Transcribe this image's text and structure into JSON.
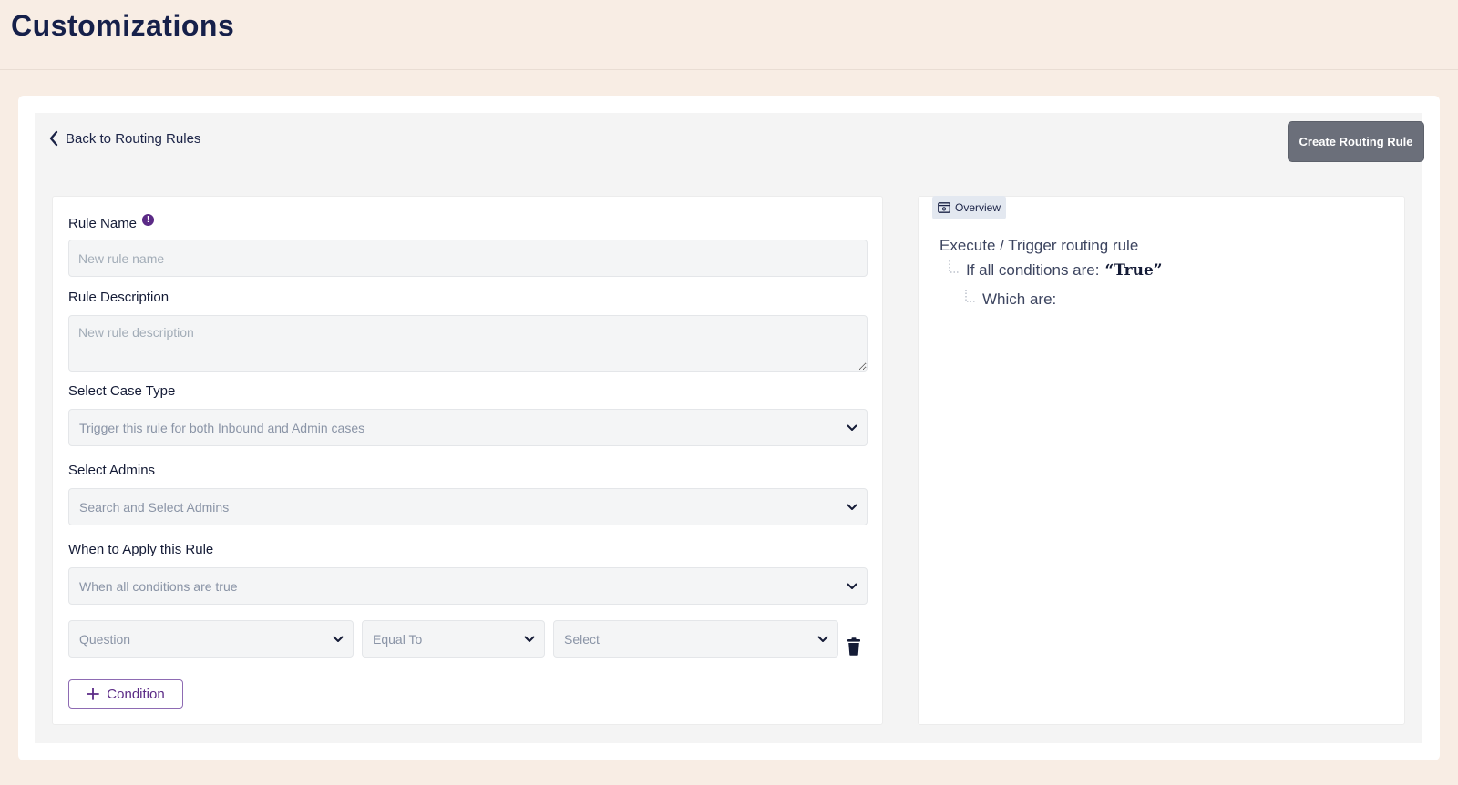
{
  "page": {
    "title": "Customizations"
  },
  "top_bar": {
    "back_label": "Back to Routing Rules",
    "create_button": "Create Routing Rule"
  },
  "form": {
    "rule_name": {
      "label": "Rule Name",
      "info_icon": "info-icon",
      "placeholder": "New rule name",
      "value": ""
    },
    "rule_description": {
      "label": "Rule Description",
      "placeholder": "New rule description",
      "value": ""
    },
    "case_type": {
      "label": "Select Case Type",
      "value": "Trigger this rule for both Inbound and Admin cases"
    },
    "admins": {
      "label": "Select Admins",
      "value": "Search and Select Admins"
    },
    "apply_when": {
      "label": "When to Apply this Rule",
      "value": "When all conditions are true"
    },
    "condition": {
      "question": "Question",
      "operator": "Equal To",
      "value": "Select",
      "delete_icon": "trash-icon"
    },
    "add_condition_label": "Condition"
  },
  "overview": {
    "tab_label": "Overview",
    "line1": "Execute / Trigger routing rule",
    "line2": "If all conditions are:",
    "line2_value": "“True”",
    "line3": "Which are:"
  },
  "colors": {
    "page_bg": "#f8ede4",
    "accent_purple": "#5b2a86",
    "button_gray": "#6b6f7a",
    "title_navy": "#16204a"
  }
}
